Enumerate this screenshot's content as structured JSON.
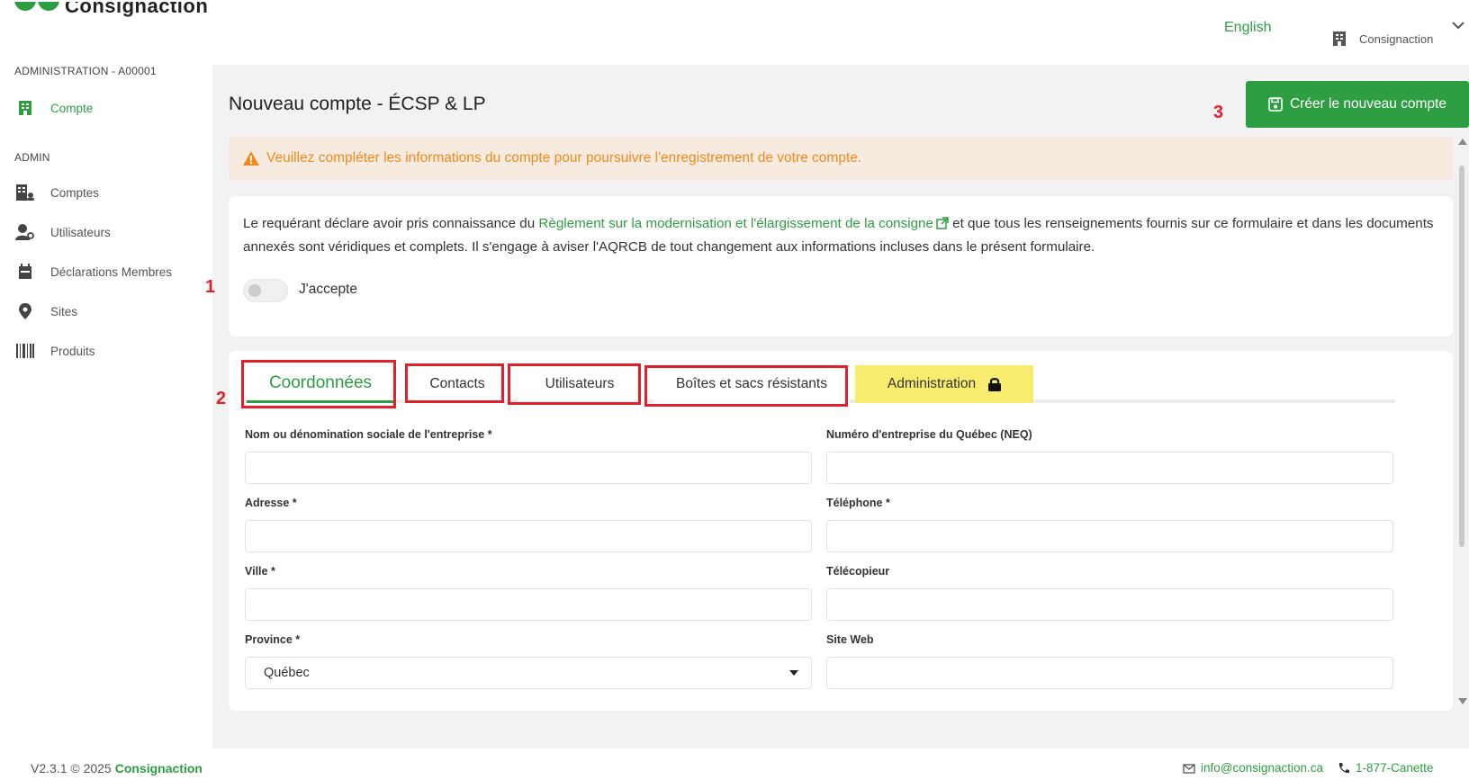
{
  "header": {
    "logo_text": "Consignaction",
    "language": "English",
    "organization": "Consignaction"
  },
  "sidebar": {
    "section1_title": "ADMINISTRATION - A00001",
    "account_item": "Compte",
    "section2_title": "ADMIN",
    "items": [
      {
        "label": "Comptes",
        "icon": "building-users-icon"
      },
      {
        "label": "Utilisateurs",
        "icon": "users-icon"
      },
      {
        "label": "Déclarations Membres",
        "icon": "calendar-icon"
      },
      {
        "label": "Sites",
        "icon": "map-pin-icon"
      },
      {
        "label": "Produits",
        "icon": "barcode-icon"
      }
    ]
  },
  "main": {
    "title": "Nouveau compte - ÉCSP & LP",
    "create_button": "Créer le nouveau compte",
    "annotations": {
      "one": "1",
      "two": "2",
      "three": "3"
    },
    "alert_text": "Veuillez compléter les informations du compte pour poursuivre l'enregistrement de votre compte.",
    "declaration": {
      "prefix": "Le requérant déclare avoir pris connaissance du ",
      "link": "Règlement sur la modernisation et l'élargissement de la consigne",
      "suffix": " et que tous les renseignements fournis sur ce formulaire et dans les documents annexés sont véridiques et complets. Il s'engage à aviser l'AQRCB de tout changement aux informations incluses dans le présent formulaire."
    },
    "accept_label": "J'accepte",
    "accept_checked": false,
    "tabs": [
      {
        "label": "Coordonnées",
        "active": true
      },
      {
        "label": "Contacts"
      },
      {
        "label": "Utilisateurs"
      },
      {
        "label": "Boîtes et sacs résistants"
      },
      {
        "label": "Administration",
        "locked": true
      }
    ],
    "form": {
      "company_name_label": "Nom ou dénomination sociale de l'entreprise *",
      "neq_label": "Numéro d'entreprise du Québec (NEQ)",
      "address_label": "Adresse *",
      "phone_label": "Téléphone *",
      "city_label": "Ville *",
      "fax_label": "Télécopieur",
      "province_label": "Province *",
      "province_value": "Québec",
      "website_label": "Site Web"
    }
  },
  "footer": {
    "version": "V2.3.1 © 2025",
    "brand": "Consignaction",
    "email": "info@consignaction.ca",
    "phone": "1-877-Canette"
  },
  "colors": {
    "accent": "#2e9e43",
    "warning": "#f08a1e",
    "annotation": "#e0202b",
    "admin_tab": "#f8ec6e"
  }
}
